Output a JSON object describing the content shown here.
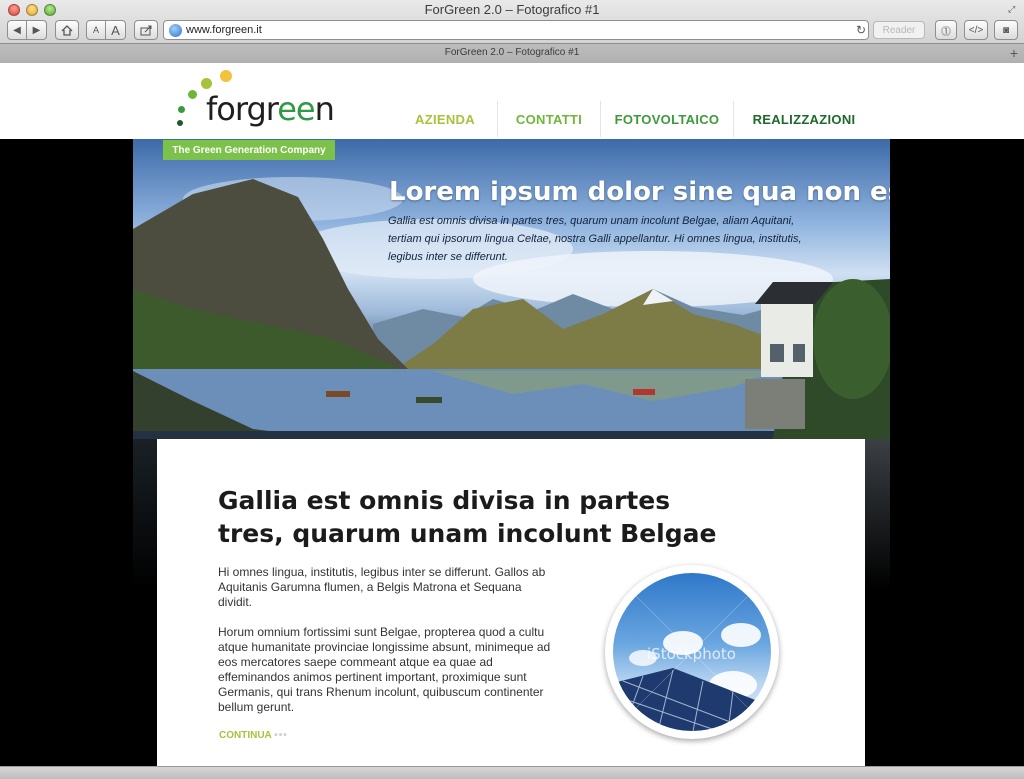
{
  "browser": {
    "window_title": "ForGreen 2.0 – Fotografico #1",
    "tab_title": "ForGreen 2.0 – Fotografico #1",
    "url": "www.forgreen.it",
    "reader_label": "Reader",
    "font_small_label": "A",
    "font_large_label": "A"
  },
  "site": {
    "logo_text_prefix": "forgr",
    "logo_text_highlight": "ee",
    "logo_text_suffix": "n",
    "tagline": "The Green Generation Company",
    "nav": [
      {
        "label": "AZIENDA",
        "color": "#a9c23b"
      },
      {
        "label": "CONTATTI",
        "color": "#6fb63a"
      },
      {
        "label": "FOTOVOLTAICO",
        "color": "#3c9a3a"
      },
      {
        "label": "REALIZZAZIONI",
        "color": "#1f6a2a"
      }
    ],
    "brand_colors": {
      "green": "#7cc24a",
      "dark_green": "#2e9a46",
      "yellow_dot": "#f2c23a"
    }
  },
  "hero": {
    "title": "Lorem ipsum dolor sine qua non est",
    "text": "Gallia est omnis divisa in partes tres, quarum unam incolunt Belgae, aliam Aquitani, tertiam qui ipsorum lingua Celtae, nostra Galli appellantur. Hi omnes lingua, institutis, legibus inter se differunt."
  },
  "content": {
    "title": "Gallia est omnis divisa in partes tres, quarum unam incolunt Belgae",
    "paragraph1": "Hi omnes lingua, institutis, legibus inter se differunt. Gallos ab Aquitanis Garumna flumen, a Belgis Matrona et Sequana dividit.",
    "paragraph2": "Horum omnium fortissimi sunt Belgae, propterea quod a cultu atque humanitate provinciae longissime absunt, minimeque ad eos mercatores saepe commeant atque ea quae ad effeminandos animos pertinent important, proximique sunt Germanis, qui trans Rhenum incolunt, quibuscum continenter bellum gerunt.",
    "continue_label": "CONTINUA",
    "continue_dots": "•••",
    "photo_watermark": "iStockphoto"
  }
}
